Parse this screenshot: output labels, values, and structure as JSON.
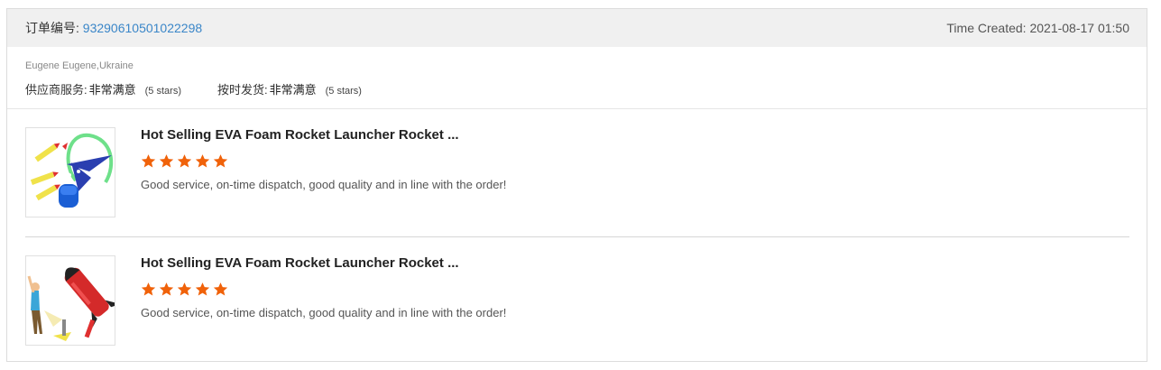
{
  "header": {
    "order_label": "订单编号: ",
    "order_number": "93290610501022298",
    "time_created": "Time Created: 2021-08-17 01:50"
  },
  "info": {
    "buyer": "Eugene Eugene,Ukraine",
    "ratings": [
      {
        "label": "供应商服务: ",
        "value": "非常满意",
        "stars_text": "(5 stars)"
      },
      {
        "label": "按时发货: ",
        "value": "非常满意",
        "stars_text": "(5 stars)"
      }
    ]
  },
  "items": [
    {
      "title": "Hot Selling EVA Foam Rocket Launcher Rocket ...",
      "rating": 5,
      "review": "Good service, on-time dispatch, good quality and in line with the order!",
      "thumbnail_icon": "rocket-launcher-product-image"
    },
    {
      "title": "Hot Selling EVA Foam Rocket Launcher Rocket ...",
      "rating": 5,
      "review": "Good service, on-time dispatch, good quality and in line with the order!",
      "thumbnail_icon": "kid-with-rocket-product-image"
    }
  ],
  "colors": {
    "star": "#f0620a",
    "order_link": "#3a86c8",
    "header_bg": "#f0f0f0"
  }
}
